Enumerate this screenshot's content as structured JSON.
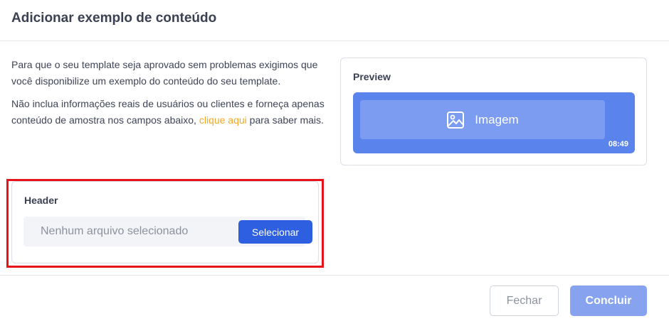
{
  "modal": {
    "title": "Adicionar exemplo de conteúdo"
  },
  "description": {
    "paragraph1": "Para que o seu template seja aprovado sem problemas exigimos que você disponibilize um exemplo do conteúdo do seu template.",
    "paragraph2_text": "Não inclua informações reais de usuários ou clientes e forneça apenas conteúdo de amostra nos campos abaixo, ",
    "paragraph2_link": "clique aqui",
    "paragraph2_end": " para saber mais."
  },
  "preview": {
    "title": "Preview",
    "media_label": "Imagem",
    "media_icon": "image-icon",
    "time": "08:49"
  },
  "header_section": {
    "title": "Header",
    "file_status": "Nenhum arquivo selecionado",
    "select_label": "Selecionar"
  },
  "footer": {
    "close_label": "Fechar",
    "done_label": "Concluir"
  },
  "colors": {
    "accent": "#2d5fe0",
    "preview_bubble": "#5b83ec",
    "link": "#f5a623",
    "highlight": "#e8121a"
  }
}
